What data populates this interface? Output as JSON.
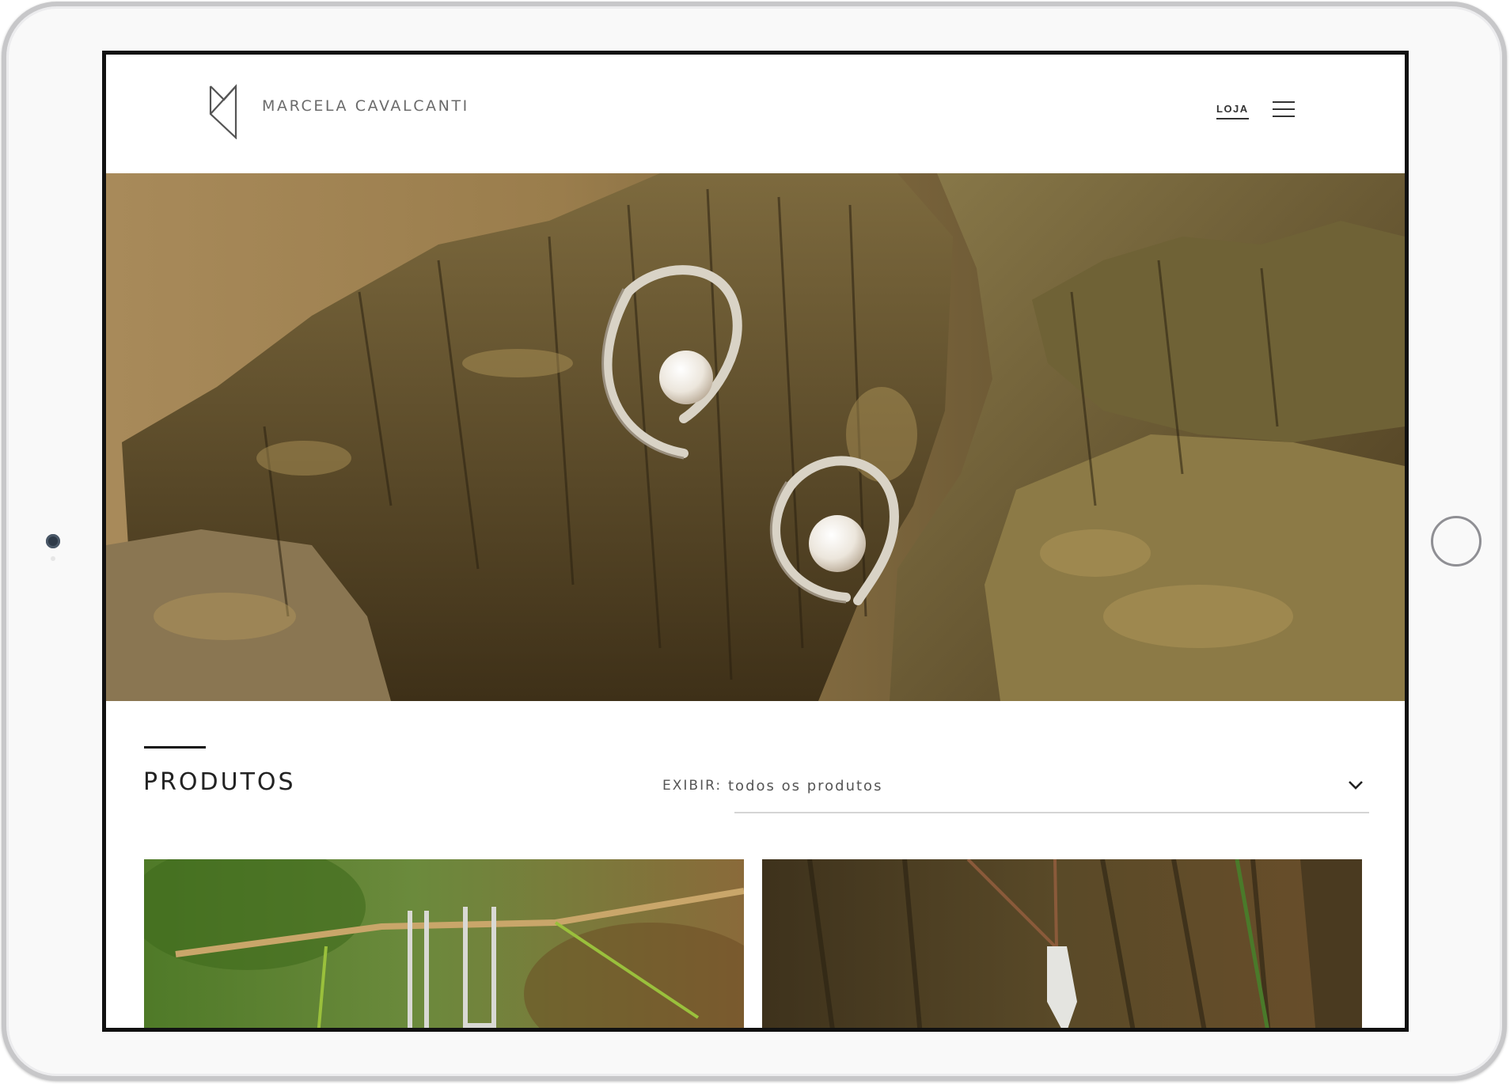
{
  "header": {
    "brand_name": "MARCELA CAVALCANTI",
    "nav_link": "LOJA",
    "menu_icon": "hamburger-menu-icon"
  },
  "hero": {
    "image_alt": "Brincos de prata com pérolas sobre tronco de madeira"
  },
  "products": {
    "title": "PRODUTOS",
    "filter_label": "EXIBIR:",
    "filter_value": "todos os produtos",
    "filter_icon": "chevron-down-icon"
  },
  "product_cards": [
    {
      "image_alt": "Brinco em forma de U sobre galho"
    },
    {
      "image_alt": "Colar com pingente sobre tronco"
    }
  ],
  "colors": {
    "text": "#222222",
    "muted": "#555555",
    "divider": "#d5d5d5",
    "device_frame": "#c7c7c9"
  }
}
